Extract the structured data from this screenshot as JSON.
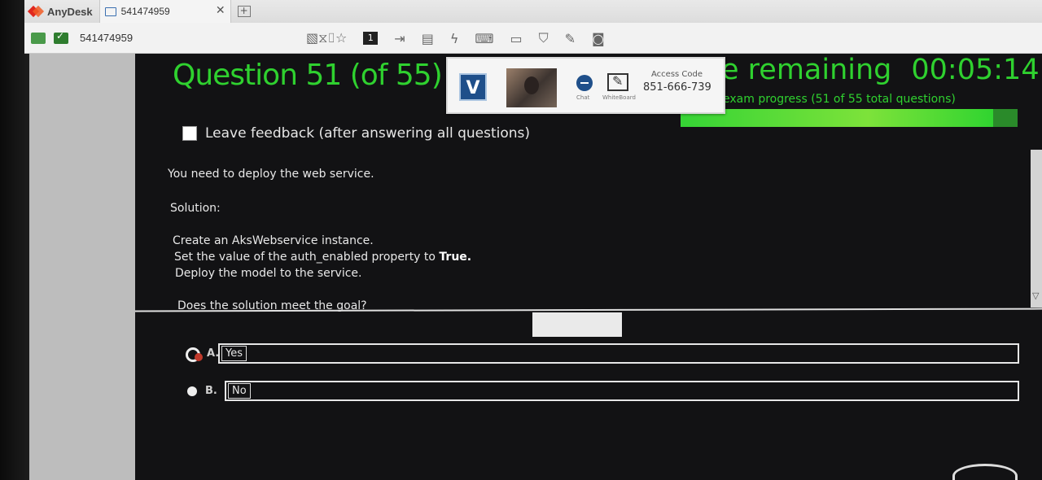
{
  "anydesk": {
    "app_name": "AnyDesk",
    "tab_label": "541474959",
    "toolbar_id": "541474959",
    "toolbar_number": "1"
  },
  "exam": {
    "question_title": "Question 51 (of 55)",
    "time_label": "e remaining",
    "time_value": "00:05:14",
    "progress_text": "exam progress (51 of 55 total questions)",
    "progress": {
      "current": 51,
      "total": 55
    },
    "feedback_label": "Leave feedback (after answering all questions)",
    "intro": "You need to deploy the web service.",
    "solution_heading": "Solution:",
    "solution_line1": "Create an AksWebservice instance.",
    "solution_line2_prefix": "Set the value of the auth_enabled property to ",
    "solution_line2_bold": "True.",
    "solution_line3": "Deploy the model to the service.",
    "goal_question": "Does the solution meet the goal?",
    "answers": [
      {
        "letter": "A.",
        "text": "Yes"
      },
      {
        "letter": "B.",
        "text": "No"
      }
    ]
  },
  "overlay": {
    "logo_letter": "V",
    "chat_label": "Chat",
    "whiteboard_label": "WhiteBoard",
    "access_code_label": "Access Code",
    "access_code": "851-666-739"
  },
  "colors": {
    "exam_green": "#2fd12f",
    "exam_background": "#121214",
    "anydesk_red": "#e0281f"
  }
}
